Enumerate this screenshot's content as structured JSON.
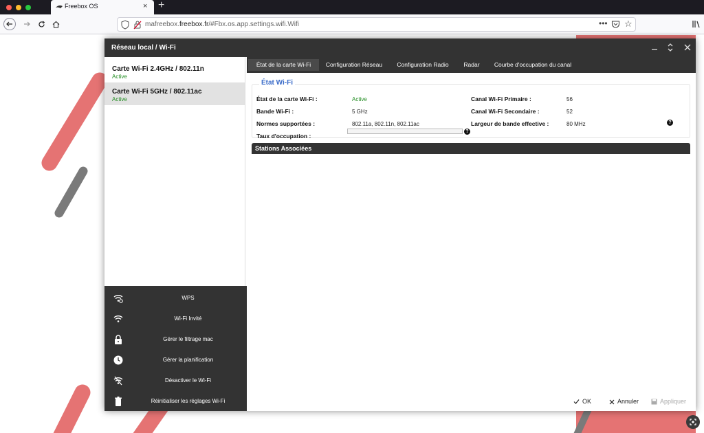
{
  "browser": {
    "tab_title": "Freebox OS",
    "url_prefix": "mafreebox.",
    "url_domain": "freebox.fr",
    "url_rest": "/#Fbx.os.app.settings.wifi.Wifi",
    "more_label": "•••",
    "new_tab_label": "+"
  },
  "window": {
    "title": "Réseau local / Wi-Fi"
  },
  "sidebar": {
    "cards": [
      {
        "name": "Carte Wi-Fi 2.4GHz / 802.11n",
        "status": "Active"
      },
      {
        "name": "Carte Wi-Fi 5GHz / 802.11ac",
        "status": "Active"
      }
    ]
  },
  "actions": [
    {
      "label": "WPS",
      "icon": "wps-icon"
    },
    {
      "label": "Wi-Fi Invité",
      "icon": "wifi-icon"
    },
    {
      "label": "Gérer le filtrage mac",
      "icon": "lock-icon"
    },
    {
      "label": "Gérer la planification",
      "icon": "clock-icon"
    },
    {
      "label": "Désactiver le Wi-Fi",
      "icon": "wifi-off-icon"
    },
    {
      "label": "Réinitialiser les réglages Wi-Fi",
      "icon": "trash-icon"
    }
  ],
  "tabs": [
    "État de la carte Wi-Fi",
    "Configuration Réseau",
    "Configuration Radio",
    "Radar",
    "Courbe d'occupation du canal"
  ],
  "status": {
    "legend": "État Wi-Fi",
    "card_state_label": "État de la carte Wi-Fi :",
    "card_state_value": "Active",
    "band_label": "Bande Wi-Fi :",
    "band_value": "5 GHz",
    "norms_label": "Normes supportées :",
    "norms_value": "802.11a, 802.11n, 802.11ac",
    "occupation_label": "Taux d'occupation :",
    "occupation_value": 0,
    "primary_label": "Canal Wi-Fi Primaire :",
    "primary_value": "56",
    "secondary_label": "Canal Wi-Fi Secondaire :",
    "secondary_value": "52",
    "bandwidth_label": "Largeur de bande effective :",
    "bandwidth_value": "80 MHz"
  },
  "stations": {
    "title": "Stations Associées"
  },
  "footer": {
    "ok": "OK",
    "cancel": "Annuler",
    "apply": "Appliquer"
  },
  "colors": {
    "accent": "#3b6cc9",
    "active_green": "#1f8b1f",
    "dark_bar": "#333333",
    "deco_red": "#e57373",
    "deco_grey": "#7a7a7a"
  }
}
